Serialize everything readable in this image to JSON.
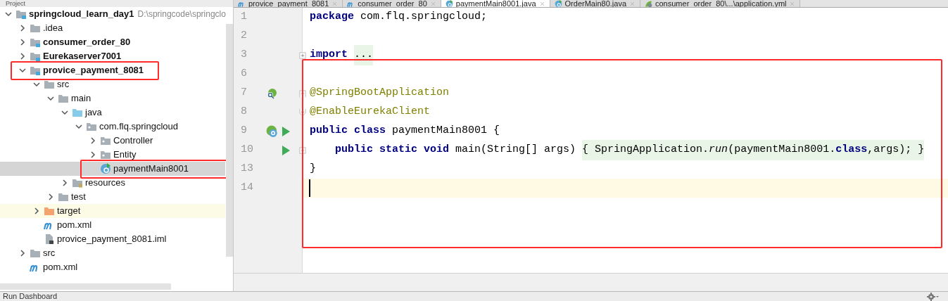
{
  "project_panel": {
    "title": "Project",
    "tree": [
      {
        "label": "springcloud_learn_day1",
        "path": "D:\\springcode\\springclo",
        "kind": "module",
        "expanded": true,
        "selected": false,
        "highlighted": false,
        "boxed": false,
        "children": [
          {
            "label": ".idea",
            "kind": "folder",
            "expanded": false,
            "selected": false,
            "highlighted": false,
            "boxed": false
          },
          {
            "label": "consumer_order_80",
            "kind": "module",
            "expanded": false,
            "selected": false,
            "highlighted": false,
            "boxed": false
          },
          {
            "label": "Eurekaserver7001",
            "kind": "module",
            "expanded": false,
            "selected": false,
            "highlighted": false,
            "boxed": false
          },
          {
            "label": "provice_payment_8081",
            "kind": "module",
            "expanded": true,
            "selected": false,
            "highlighted": false,
            "boxed": true,
            "children": [
              {
                "label": "src",
                "kind": "folder",
                "expanded": true,
                "selected": false,
                "highlighted": false,
                "boxed": false,
                "children": [
                  {
                    "label": "main",
                    "kind": "folder",
                    "expanded": true,
                    "selected": false,
                    "highlighted": false,
                    "boxed": false,
                    "children": [
                      {
                        "label": "java",
                        "kind": "source",
                        "expanded": true,
                        "selected": false,
                        "highlighted": false,
                        "boxed": false,
                        "children": [
                          {
                            "label": "com.flq.springcloud",
                            "kind": "package",
                            "expanded": true,
                            "selected": false,
                            "highlighted": false,
                            "boxed": false,
                            "children": [
                              {
                                "label": "Controller",
                                "kind": "package",
                                "expanded": false,
                                "selected": false,
                                "highlighted": false,
                                "boxed": false
                              },
                              {
                                "label": "Entity",
                                "kind": "package",
                                "expanded": false,
                                "selected": false,
                                "highlighted": false,
                                "boxed": false
                              },
                              {
                                "label": "paymentMain8001",
                                "kind": "class",
                                "selected": true,
                                "highlighted": false,
                                "boxed": true
                              }
                            ]
                          }
                        ]
                      },
                      {
                        "label": "resources",
                        "kind": "resources",
                        "expanded": false,
                        "selected": false,
                        "highlighted": false,
                        "boxed": false
                      }
                    ]
                  },
                  {
                    "label": "test",
                    "kind": "folder",
                    "expanded": false,
                    "selected": false,
                    "highlighted": false,
                    "boxed": false
                  }
                ]
              },
              {
                "label": "target",
                "kind": "excluded",
                "expanded": false,
                "selected": false,
                "highlighted": true,
                "boxed": false
              },
              {
                "label": "pom.xml",
                "kind": "maven",
                "selected": false,
                "highlighted": false,
                "boxed": false
              },
              {
                "label": "provice_payment_8081.iml",
                "kind": "iml",
                "selected": false,
                "highlighted": false,
                "boxed": false
              }
            ]
          },
          {
            "label": "src",
            "kind": "folder",
            "expanded": false,
            "selected": false,
            "highlighted": false,
            "boxed": false
          },
          {
            "label": "pom.xml",
            "kind": "maven",
            "selected": false,
            "highlighted": false,
            "boxed": false
          }
        ]
      }
    ]
  },
  "editor_tabs": [
    {
      "label": "provice_payment_8081",
      "kind": "maven",
      "selected": false
    },
    {
      "label": "consumer_order_80",
      "kind": "maven",
      "selected": false
    },
    {
      "label": "paymentMain8001.java",
      "kind": "class",
      "selected": true
    },
    {
      "label": "OrderMain80.java",
      "kind": "class",
      "selected": false
    },
    {
      "label": "consumer_order_80\\...\\application.yml",
      "kind": "spring",
      "selected": false
    }
  ],
  "editor": {
    "lines": [
      {
        "number": "1",
        "current": false,
        "tokens": [
          {
            "text": "package",
            "kind": "keyword",
            "folded": false
          },
          {
            "text": " com.flq.springcloud;",
            "kind": "plain",
            "folded": false
          }
        ]
      },
      {
        "number": "2",
        "current": false
      },
      {
        "number": "3",
        "current": false,
        "fold": {
          "kind": "plus"
        },
        "tokens": [
          {
            "text": "import",
            "kind": "keyword",
            "folded": false
          },
          {
            "text": "...",
            "kind": "plain",
            "folded": true
          }
        ]
      }
    ],
    "boxed_lines": [
      {
        "number": "6",
        "current": false
      },
      {
        "number": "7",
        "current": false,
        "gutter": [
          {
            "kind": "bean"
          }
        ],
        "fold": {
          "kind": "minus"
        },
        "tokens": [
          {
            "text": "@SpringBootApplication",
            "kind": "annotation",
            "folded": false
          }
        ]
      },
      {
        "number": "8",
        "current": false,
        "fold": {
          "kind": "end"
        },
        "tokens": [
          {
            "text": "@EnableEurekaClient",
            "kind": "annotation",
            "folded": false
          }
        ]
      },
      {
        "number": "9",
        "current": false,
        "gutter": [
          {
            "kind": "class"
          },
          {
            "kind": "run"
          }
        ],
        "tokens": [
          {
            "text": "public class",
            "kind": "keyword",
            "folded": false
          },
          {
            "text": " paymentMain8001 {",
            "kind": "plain",
            "folded": false
          }
        ]
      },
      {
        "number": "10",
        "current": false,
        "gutter": [
          {
            "kind": "run"
          }
        ],
        "fold": {
          "kind": "plus"
        },
        "tokens": [
          {
            "text": "    public static void",
            "kind": "keyword",
            "folded": false
          },
          {
            "text": " main(String[] args)",
            "kind": "plain",
            "folded": false
          },
          {
            "text": "{ SpringApplication.",
            "kind": "plain",
            "folded": true
          },
          {
            "text": "run",
            "kind": "call",
            "folded": true
          },
          {
            "text": "(paymentMain8001.",
            "kind": "plain",
            "folded": true
          },
          {
            "text": "class",
            "kind": "keyword",
            "folded": true
          },
          {
            "text": ",args); }",
            "kind": "plain",
            "folded": true
          }
        ]
      },
      {
        "number": "13",
        "current": false,
        "tokens": [
          {
            "text": "}",
            "kind": "plain",
            "folded": false
          }
        ]
      },
      {
        "number": "14",
        "current": true
      }
    ]
  },
  "bottom_bar": {
    "label": "Run Dashboard"
  }
}
